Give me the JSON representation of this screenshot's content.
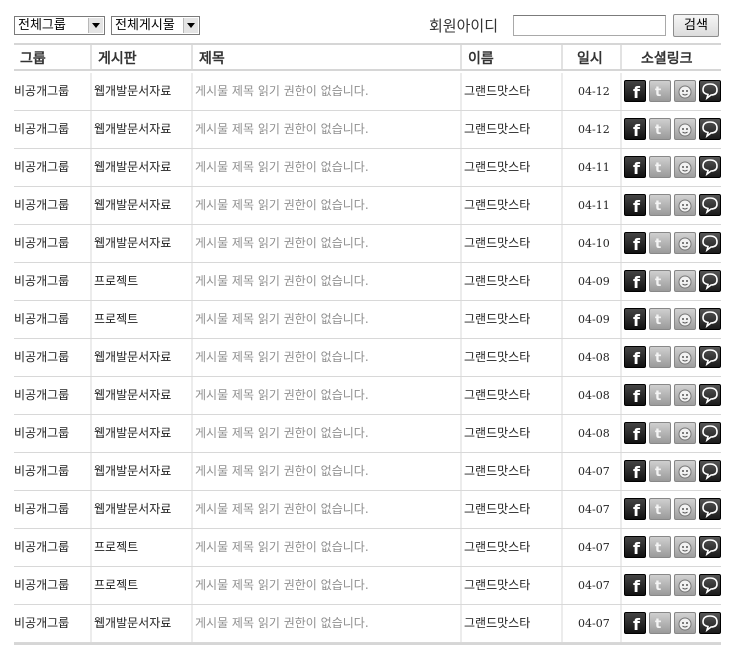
{
  "filters": {
    "group_select": "전체그룹",
    "board_select": "전체게시물",
    "member_label": "회원아이디",
    "member_input_value": "",
    "search_button": "검색"
  },
  "table": {
    "headers": [
      "그룹",
      "게시판",
      "제목",
      "이름",
      "일시",
      "소셜링크"
    ],
    "social_icons": [
      "facebook-icon",
      "twitter-icon",
      "me2day-icon",
      "yozm-icon"
    ],
    "rows": [
      {
        "group": "비공개그룹",
        "board": "웹개발문서자료",
        "title": "게시물 제목 읽기 권한이 없습니다.",
        "name": "그랜드맛스타",
        "date": "04-12"
      },
      {
        "group": "비공개그룹",
        "board": "웹개발문서자료",
        "title": "게시물 제목 읽기 권한이 없습니다.",
        "name": "그랜드맛스타",
        "date": "04-12"
      },
      {
        "group": "비공개그룹",
        "board": "웹개발문서자료",
        "title": "게시물 제목 읽기 권한이 없습니다.",
        "name": "그랜드맛스타",
        "date": "04-11"
      },
      {
        "group": "비공개그룹",
        "board": "웹개발문서자료",
        "title": "게시물 제목 읽기 권한이 없습니다.",
        "name": "그랜드맛스타",
        "date": "04-11"
      },
      {
        "group": "비공개그룹",
        "board": "웹개발문서자료",
        "title": "게시물 제목 읽기 권한이 없습니다.",
        "name": "그랜드맛스타",
        "date": "04-10"
      },
      {
        "group": "비공개그룹",
        "board": "프로젝트",
        "title": "게시물 제목 읽기 권한이 없습니다.",
        "name": "그랜드맛스타",
        "date": "04-09"
      },
      {
        "group": "비공개그룹",
        "board": "프로젝트",
        "title": "게시물 제목 읽기 권한이 없습니다.",
        "name": "그랜드맛스타",
        "date": "04-09"
      },
      {
        "group": "비공개그룹",
        "board": "웹개발문서자료",
        "title": "게시물 제목 읽기 권한이 없습니다.",
        "name": "그랜드맛스타",
        "date": "04-08"
      },
      {
        "group": "비공개그룹",
        "board": "웹개발문서자료",
        "title": "게시물 제목 읽기 권한이 없습니다.",
        "name": "그랜드맛스타",
        "date": "04-08"
      },
      {
        "group": "비공개그룹",
        "board": "웹개발문서자료",
        "title": "게시물 제목 읽기 권한이 없습니다.",
        "name": "그랜드맛스타",
        "date": "04-08"
      },
      {
        "group": "비공개그룹",
        "board": "웹개발문서자료",
        "title": "게시물 제목 읽기 권한이 없습니다.",
        "name": "그랜드맛스타",
        "date": "04-07"
      },
      {
        "group": "비공개그룹",
        "board": "웹개발문서자료",
        "title": "게시물 제목 읽기 권한이 없습니다.",
        "name": "그랜드맛스타",
        "date": "04-07"
      },
      {
        "group": "비공개그룹",
        "board": "프로젝트",
        "title": "게시물 제목 읽기 권한이 없습니다.",
        "name": "그랜드맛스타",
        "date": "04-07"
      },
      {
        "group": "비공개그룹",
        "board": "프로젝트",
        "title": "게시물 제목 읽기 권한이 없습니다.",
        "name": "그랜드맛스타",
        "date": "04-07"
      },
      {
        "group": "비공개그룹",
        "board": "웹개발문서자료",
        "title": "게시물 제목 읽기 권한이 없습니다.",
        "name": "그랜드맛스타",
        "date": "04-07"
      }
    ]
  }
}
